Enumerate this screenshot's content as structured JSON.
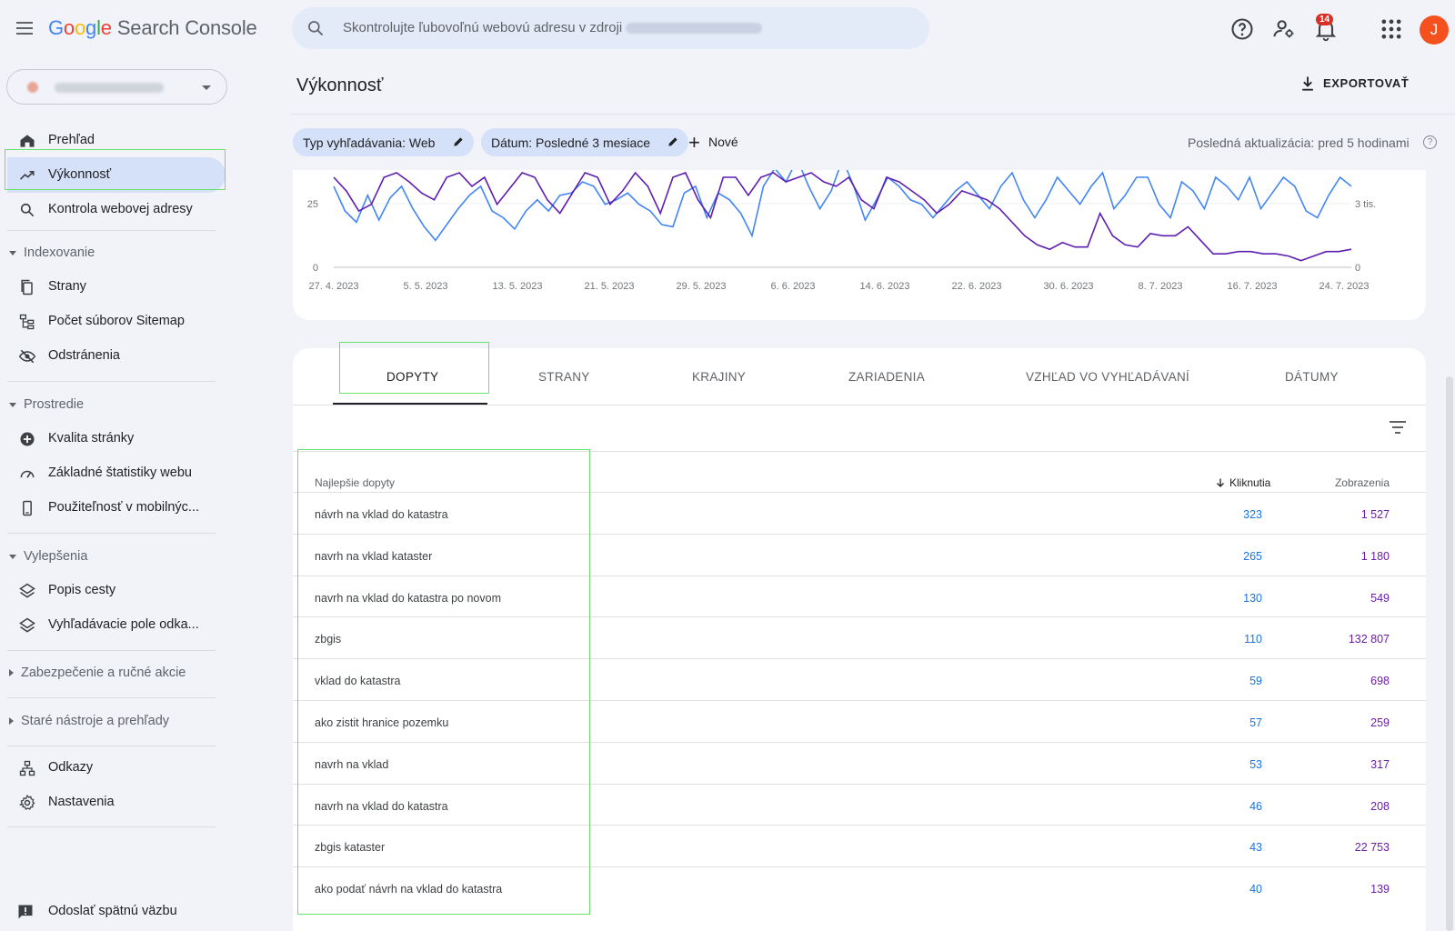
{
  "app": {
    "logo_parts": [
      "G",
      "o",
      "o",
      "g",
      "l",
      "e"
    ],
    "logo_product": "Search Console"
  },
  "search": {
    "placeholder": "Skontrolujte ľubovoľnú webovú adresu v zdroji"
  },
  "header": {
    "notification_count": "14",
    "avatar_initial": "J"
  },
  "sidebar": {
    "items": [
      {
        "label": "Prehľad",
        "icon": "home-icon"
      },
      {
        "label": "Výkonnosť",
        "icon": "trending-up-icon"
      },
      {
        "label": "Kontrola webovej adresy",
        "icon": "search-icon"
      },
      {
        "label": "Strany",
        "icon": "pages-icon"
      },
      {
        "label": "Počet súborov Sitemap",
        "icon": "sitemap-icon"
      },
      {
        "label": "Odstránenia",
        "icon": "eye-off-icon"
      },
      {
        "label": "Kvalita stránky",
        "icon": "plus-circle-icon"
      },
      {
        "label": "Základné štatistiky webu",
        "icon": "gauge-icon"
      },
      {
        "label": "Použiteľnosť v mobilnýc...",
        "icon": "phone-icon"
      },
      {
        "label": "Popis cesty",
        "icon": "layers-icon"
      },
      {
        "label": "Vyhľadávacie pole odka...",
        "icon": "layers-icon"
      },
      {
        "label": "Odkazy",
        "icon": "links-icon"
      },
      {
        "label": "Nastavenia",
        "icon": "gear-icon"
      }
    ],
    "sections": [
      "Indexovanie",
      "Prostredie",
      "Vylepšenia",
      "Zabezpečenie a ručné akcie",
      "Staré nástroje a prehľady"
    ],
    "feedback": "Odoslať spätnú väzbu"
  },
  "page": {
    "title": "Výkonnosť",
    "export_label": "EXPORTOVAŤ",
    "chips": [
      "Typ vyhľadávania: Web",
      "Dátum: Posledné 3 mesiace"
    ],
    "new_label": "Nové",
    "last_update": "Posledná aktualizácia: pred 5 hodinami"
  },
  "chart_data": {
    "type": "line",
    "x_ticks": [
      "27. 4. 2023",
      "5. 5. 2023",
      "13. 5. 2023",
      "21. 5. 2023",
      "29. 5. 2023",
      "6. 6. 2023",
      "14. 6. 2023",
      "22. 6. 2023",
      "30. 6. 2023",
      "8. 7. 2023",
      "16. 7. 2023",
      "24. 7. 2023"
    ],
    "y_left_ticks": [
      "25",
      "0"
    ],
    "y_right_ticks": [
      "3 tis.",
      "0"
    ],
    "series": [
      {
        "color": "#4285f4",
        "values": [
          36,
          25,
          20,
          32,
          21,
          31,
          36,
          26,
          18,
          12,
          19,
          26,
          32,
          36,
          25,
          22,
          17,
          25,
          30,
          25,
          32,
          33,
          38,
          36,
          28,
          30,
          33,
          28,
          25,
          19,
          18,
          33,
          36,
          22,
          33,
          30,
          24,
          14,
          36,
          44,
          38,
          48,
          36,
          26,
          34,
          48,
          36,
          21,
          30,
          40,
          36,
          30,
          28,
          22,
          28,
          34,
          38,
          32,
          26,
          36,
          42,
          30,
          22,
          30,
          40,
          34,
          28,
          36,
          42,
          26,
          32,
          40,
          40,
          28,
          22,
          38,
          34,
          26,
          40,
          36,
          30,
          40,
          26,
          33,
          40,
          36,
          25,
          22,
          32,
          40,
          36
        ]
      },
      {
        "color": "#5e1eb0",
        "values": [
          40,
          34,
          25,
          28,
          40,
          42,
          38,
          33,
          30,
          40,
          42,
          36,
          40,
          28,
          35,
          42,
          40,
          30,
          24,
          33,
          42,
          40,
          28,
          34,
          42,
          36,
          24,
          40,
          42,
          30,
          22,
          40,
          40,
          32,
          40,
          42,
          38,
          40,
          42,
          38,
          36,
          40,
          30,
          26,
          40,
          38,
          34,
          30,
          24,
          28,
          34,
          32,
          30,
          26,
          20,
          14,
          10,
          8,
          11,
          9,
          9,
          24,
          14,
          10,
          9,
          15,
          14,
          14,
          18,
          12,
          6,
          6,
          7,
          7,
          6,
          6,
          5,
          3,
          5,
          7,
          7,
          8
        ]
      }
    ]
  },
  "tabs": [
    "DOPYTY",
    "STRANY",
    "KRAJINY",
    "ZARIADENIA",
    "VZHĽAD VO VYHĽADÁVANÍ",
    "DÁTUMY"
  ],
  "table": {
    "col_query": "Najlepšie dopyty",
    "col_clicks": "Kliknutia",
    "col_impressions": "Zobrazenia",
    "rows": [
      {
        "query": "návrh na vklad do katastra",
        "clicks": "323",
        "impressions": "1 527"
      },
      {
        "query": "navrh na vklad kataster",
        "clicks": "265",
        "impressions": "1 180"
      },
      {
        "query": "navrh na vklad do katastra po novom",
        "clicks": "130",
        "impressions": "549"
      },
      {
        "query": "zbgis",
        "clicks": "110",
        "impressions": "132 807"
      },
      {
        "query": "vklad do katastra",
        "clicks": "59",
        "impressions": "698"
      },
      {
        "query": "ako zistit hranice pozemku",
        "clicks": "57",
        "impressions": "259"
      },
      {
        "query": "navrh na vklad",
        "clicks": "53",
        "impressions": "317"
      },
      {
        "query": "navrh na vklad do katastra",
        "clicks": "46",
        "impressions": "208"
      },
      {
        "query": "zbgis kataster",
        "clicks": "43",
        "impressions": "22 753"
      },
      {
        "query": "ako podať návrh na vklad do katastra",
        "clicks": "40",
        "impressions": "139"
      }
    ]
  },
  "colors": {
    "accent": "#1a73e8",
    "impressions": "#6b1ea6",
    "active_nav": "#d4e1f8",
    "highlight_box": "#67e26a"
  }
}
